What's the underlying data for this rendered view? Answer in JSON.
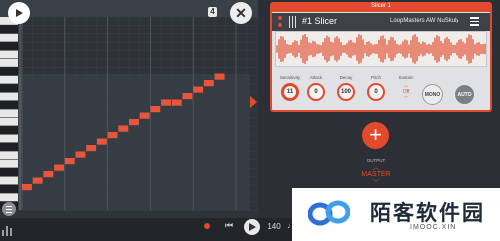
{
  "colors": {
    "accent": "#e24a2d",
    "roll_background": "#2e3339",
    "roll_grid": "#3b4148",
    "roll_bar_line": "#525962",
    "panel_background": "#dfe1e4",
    "note_color": "#e8553a"
  },
  "piano_roll": {
    "ruler_marker": "4",
    "notes": [
      {
        "step": 0,
        "pitch": 0
      },
      {
        "step": 1,
        "pitch": 1
      },
      {
        "step": 2,
        "pitch": 2
      },
      {
        "step": 3,
        "pitch": 3
      },
      {
        "step": 4,
        "pitch": 4
      },
      {
        "step": 5,
        "pitch": 5
      },
      {
        "step": 6,
        "pitch": 6
      },
      {
        "step": 7,
        "pitch": 7
      },
      {
        "step": 8,
        "pitch": 8
      },
      {
        "step": 9,
        "pitch": 9
      },
      {
        "step": 10,
        "pitch": 10
      },
      {
        "step": 11,
        "pitch": 11
      },
      {
        "step": 12,
        "pitch": 12
      },
      {
        "step": 13,
        "pitch": 13
      },
      {
        "step": 14,
        "pitch": 13
      },
      {
        "step": 15,
        "pitch": 14
      },
      {
        "step": 16,
        "pitch": 15
      },
      {
        "step": 17,
        "pitch": 16
      },
      {
        "step": 18,
        "pitch": 17
      }
    ]
  },
  "slicer": {
    "window_title": "Slicer 1",
    "channel_name": "#1 Slicer",
    "preset": "LoopMasters AW NuSkul",
    "preset_next": "›",
    "knobs": [
      {
        "label": "Sensitivity",
        "value": "11"
      },
      {
        "label": "Attack",
        "value": "0"
      },
      {
        "label": "Decay",
        "value": "100"
      },
      {
        "label": "Pitch",
        "value": "0"
      }
    ],
    "sustain": {
      "label": "Sustain",
      "value": "Off"
    },
    "mono_label": "MONO",
    "auto_label": "AUTO"
  },
  "mixer": {
    "add_label": "+",
    "output_label": "OUTPUT",
    "output_value": "MASTER"
  },
  "transport": {
    "tempo": "140",
    "prev_icon": "skip-back-icon",
    "more": "•••",
    "metronome": "♩"
  },
  "watermark": {
    "title": "陌客软件园",
    "subtitle": "IMOOC.XIN"
  }
}
